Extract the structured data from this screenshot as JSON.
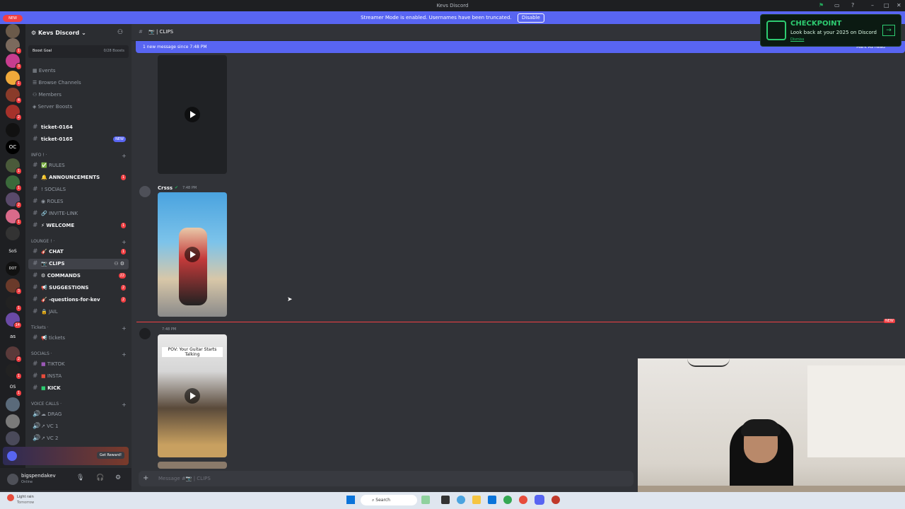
{
  "window": {
    "title": "Kevs Discord"
  },
  "banner": {
    "text": "Streamer Mode is enabled. Usernames have been truncated.",
    "button": "Disable"
  },
  "rail": {
    "new_label": "NEW",
    "badges": [
      "1",
      "3",
      "1",
      "4",
      "2",
      "1",
      "1",
      "2",
      "1",
      "3",
      "1",
      "14",
      "2",
      "1",
      "1",
      "12",
      "2",
      "449",
      "2"
    ]
  },
  "server": {
    "name": "Kevs Discord",
    "boost_goal": "Boost Goal",
    "boost_count": "0/28 Boosts"
  },
  "nav": {
    "events": "Events",
    "browse": "Browse Channels",
    "members": "Members",
    "boosts": "Server Boosts"
  },
  "channels": {
    "ticket1": "ticket-0164",
    "ticket2": "ticket-0165",
    "ticket2_badge": "NEW",
    "cat_info": "INFO ! ·",
    "rules": "RULES",
    "announcements": "ANNOUNCEMENTS",
    "announcements_count": "1",
    "socials": "SOCIALS",
    "roles": "ROLES",
    "invite": "INVITE-LINK",
    "welcome": "WELCOME",
    "welcome_count": "1",
    "cat_lounge": "LOUNGE ! ·",
    "chat": "CHAT",
    "chat_count": "1",
    "clips": "CLIPS",
    "commands": "COMMANDS",
    "commands_count": "22",
    "suggestions": "SUGGESTIONS",
    "suggestions_count": "2",
    "questions": "-questions-for-kev",
    "questions_count": "2",
    "jail": "JAIL",
    "cat_tickets": "Tickets ·",
    "tickets": "tickets",
    "cat_socials": "SOCIALS ·",
    "tiktok": "TIKTOK",
    "insta": "INSTA",
    "kick": "KICK",
    "cat_voice": "VOICE CALLS ·",
    "drag": "DRAG",
    "vc1": "VC 1",
    "vc2": "VC 2"
  },
  "promo": {
    "button": "Get Reward!"
  },
  "user": {
    "name": "bigspendakev",
    "status": "Online"
  },
  "chat": {
    "channel": "CLIPS",
    "new_since": "1 new message since 7:48 PM",
    "mark_read": "Mark As Read",
    "msg1_author": "Crsss",
    "msg1_time": "7:48 PM",
    "msg2_time": "7:48 PM",
    "video_caption": "POV: Your Guitar Starts Talking",
    "new_divider": "NEW",
    "input_placeholder": "Message #📷 | CLIPS"
  },
  "checkpoint": {
    "title": "CHECKPOINT",
    "subtitle": "Look back at your 2025 on Discord",
    "link": "Dismiss"
  },
  "taskbar": {
    "weather": "Light rain",
    "weather_sub": "Tomorrow",
    "search": "Search"
  }
}
